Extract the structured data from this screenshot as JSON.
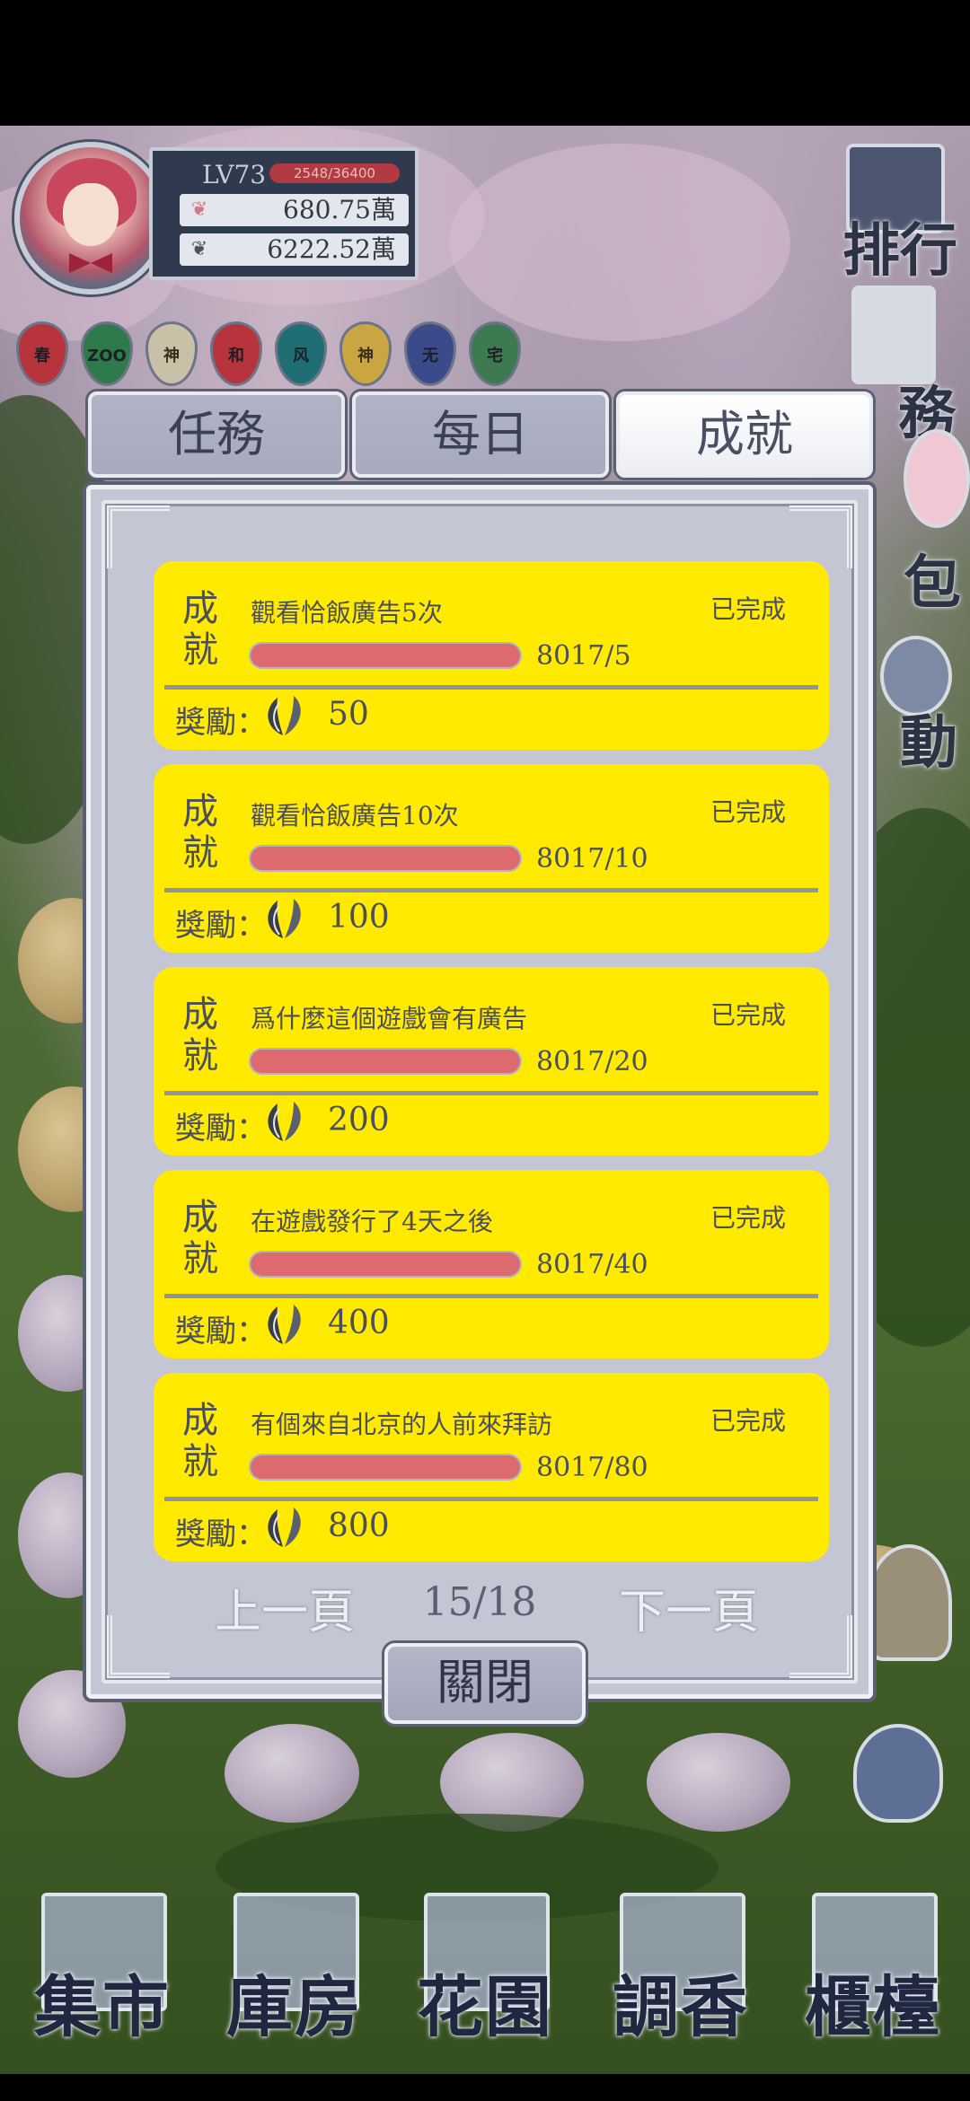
{
  "player": {
    "level": "LV73",
    "exp_text": "2548/36400",
    "exp_fraction": 0.07,
    "currency_pink": "680.75萬",
    "currency_gray": "6222.52萬"
  },
  "badges": [
    {
      "icon": "春",
      "color": "#b8343c"
    },
    {
      "icon": "ZOO",
      "color": "#2f7a4a"
    },
    {
      "icon": "神",
      "color": "#c9c0a8"
    },
    {
      "icon": "和",
      "color": "#b8343c"
    },
    {
      "icon": "风",
      "color": "#1f6e74"
    },
    {
      "icon": "神",
      "color": "#c9a642"
    },
    {
      "icon": "无",
      "color": "#3a4a8a"
    },
    {
      "icon": "宅",
      "color": "#3d7a52"
    }
  ],
  "side_menu": {
    "ranking": "排行",
    "task": "務",
    "bag": "包",
    "event": "動"
  },
  "tabs": [
    {
      "label": "任務",
      "active": false
    },
    {
      "label": "每日",
      "active": false
    },
    {
      "label": "成就",
      "active": true
    }
  ],
  "achievements": [
    {
      "tag": "成就",
      "title": "觀看恰飯廣告5次",
      "status": "已完成",
      "progress": "8017/5",
      "fraction": 1.0,
      "reward_label": "獎勵：",
      "reward": "50"
    },
    {
      "tag": "成就",
      "title": "觀看恰飯廣告10次",
      "status": "已完成",
      "progress": "8017/10",
      "fraction": 1.0,
      "reward_label": "獎勵：",
      "reward": "100"
    },
    {
      "tag": "成就",
      "title": "爲什麼這個遊戲會有廣告",
      "status": "已完成",
      "progress": "8017/20",
      "fraction": 1.0,
      "reward_label": "獎勵：",
      "reward": "200"
    },
    {
      "tag": "成就",
      "title": "在遊戲發行了4天之後",
      "status": "已完成",
      "progress": "8017/40",
      "fraction": 1.0,
      "reward_label": "獎勵：",
      "reward": "400"
    },
    {
      "tag": "成就",
      "title": "有個來自北京的人前來拜訪",
      "status": "已完成",
      "progress": "8017/80",
      "fraction": 1.0,
      "reward_label": "獎勵：",
      "reward": "800"
    }
  ],
  "pager": {
    "prev": "上一頁",
    "page": "15/18",
    "next": "下一頁"
  },
  "close_label": "關閉",
  "bottom_nav": [
    {
      "label": "集市",
      "icon": "market-icon"
    },
    {
      "label": "庫房",
      "icon": "warehouse-icon"
    },
    {
      "label": "花園",
      "icon": "garden-icon"
    },
    {
      "label": "調香",
      "icon": "perfume-icon"
    },
    {
      "label": "櫃檯",
      "icon": "counter-icon"
    }
  ],
  "colors": {
    "card": "#ffea00",
    "progress_fill": "#dc6a6e",
    "modal": "#c5c6d3"
  }
}
